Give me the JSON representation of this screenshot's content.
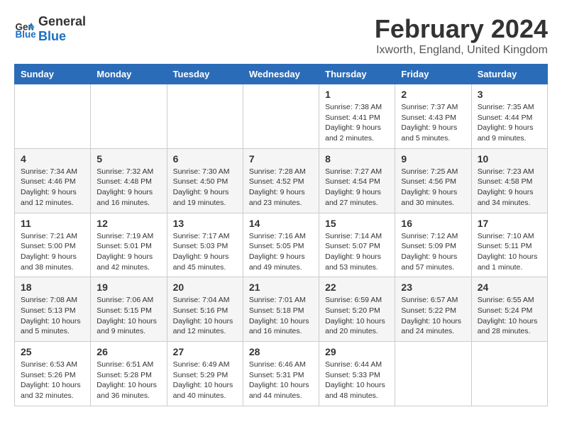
{
  "logo": {
    "line1": "General",
    "line2": "Blue"
  },
  "title": {
    "month_year": "February 2024",
    "location": "Ixworth, England, United Kingdom"
  },
  "days_of_week": [
    "Sunday",
    "Monday",
    "Tuesday",
    "Wednesday",
    "Thursday",
    "Friday",
    "Saturday"
  ],
  "weeks": [
    [
      {
        "day": "",
        "info": ""
      },
      {
        "day": "",
        "info": ""
      },
      {
        "day": "",
        "info": ""
      },
      {
        "day": "",
        "info": ""
      },
      {
        "day": "1",
        "info": "Sunrise: 7:38 AM\nSunset: 4:41 PM\nDaylight: 9 hours\nand 2 minutes."
      },
      {
        "day": "2",
        "info": "Sunrise: 7:37 AM\nSunset: 4:43 PM\nDaylight: 9 hours\nand 5 minutes."
      },
      {
        "day": "3",
        "info": "Sunrise: 7:35 AM\nSunset: 4:44 PM\nDaylight: 9 hours\nand 9 minutes."
      }
    ],
    [
      {
        "day": "4",
        "info": "Sunrise: 7:34 AM\nSunset: 4:46 PM\nDaylight: 9 hours\nand 12 minutes."
      },
      {
        "day": "5",
        "info": "Sunrise: 7:32 AM\nSunset: 4:48 PM\nDaylight: 9 hours\nand 16 minutes."
      },
      {
        "day": "6",
        "info": "Sunrise: 7:30 AM\nSunset: 4:50 PM\nDaylight: 9 hours\nand 19 minutes."
      },
      {
        "day": "7",
        "info": "Sunrise: 7:28 AM\nSunset: 4:52 PM\nDaylight: 9 hours\nand 23 minutes."
      },
      {
        "day": "8",
        "info": "Sunrise: 7:27 AM\nSunset: 4:54 PM\nDaylight: 9 hours\nand 27 minutes."
      },
      {
        "day": "9",
        "info": "Sunrise: 7:25 AM\nSunset: 4:56 PM\nDaylight: 9 hours\nand 30 minutes."
      },
      {
        "day": "10",
        "info": "Sunrise: 7:23 AM\nSunset: 4:58 PM\nDaylight: 9 hours\nand 34 minutes."
      }
    ],
    [
      {
        "day": "11",
        "info": "Sunrise: 7:21 AM\nSunset: 5:00 PM\nDaylight: 9 hours\nand 38 minutes."
      },
      {
        "day": "12",
        "info": "Sunrise: 7:19 AM\nSunset: 5:01 PM\nDaylight: 9 hours\nand 42 minutes."
      },
      {
        "day": "13",
        "info": "Sunrise: 7:17 AM\nSunset: 5:03 PM\nDaylight: 9 hours\nand 45 minutes."
      },
      {
        "day": "14",
        "info": "Sunrise: 7:16 AM\nSunset: 5:05 PM\nDaylight: 9 hours\nand 49 minutes."
      },
      {
        "day": "15",
        "info": "Sunrise: 7:14 AM\nSunset: 5:07 PM\nDaylight: 9 hours\nand 53 minutes."
      },
      {
        "day": "16",
        "info": "Sunrise: 7:12 AM\nSunset: 5:09 PM\nDaylight: 9 hours\nand 57 minutes."
      },
      {
        "day": "17",
        "info": "Sunrise: 7:10 AM\nSunset: 5:11 PM\nDaylight: 10 hours\nand 1 minute."
      }
    ],
    [
      {
        "day": "18",
        "info": "Sunrise: 7:08 AM\nSunset: 5:13 PM\nDaylight: 10 hours\nand 5 minutes."
      },
      {
        "day": "19",
        "info": "Sunrise: 7:06 AM\nSunset: 5:15 PM\nDaylight: 10 hours\nand 9 minutes."
      },
      {
        "day": "20",
        "info": "Sunrise: 7:04 AM\nSunset: 5:16 PM\nDaylight: 10 hours\nand 12 minutes."
      },
      {
        "day": "21",
        "info": "Sunrise: 7:01 AM\nSunset: 5:18 PM\nDaylight: 10 hours\nand 16 minutes."
      },
      {
        "day": "22",
        "info": "Sunrise: 6:59 AM\nSunset: 5:20 PM\nDaylight: 10 hours\nand 20 minutes."
      },
      {
        "day": "23",
        "info": "Sunrise: 6:57 AM\nSunset: 5:22 PM\nDaylight: 10 hours\nand 24 minutes."
      },
      {
        "day": "24",
        "info": "Sunrise: 6:55 AM\nSunset: 5:24 PM\nDaylight: 10 hours\nand 28 minutes."
      }
    ],
    [
      {
        "day": "25",
        "info": "Sunrise: 6:53 AM\nSunset: 5:26 PM\nDaylight: 10 hours\nand 32 minutes."
      },
      {
        "day": "26",
        "info": "Sunrise: 6:51 AM\nSunset: 5:28 PM\nDaylight: 10 hours\nand 36 minutes."
      },
      {
        "day": "27",
        "info": "Sunrise: 6:49 AM\nSunset: 5:29 PM\nDaylight: 10 hours\nand 40 minutes."
      },
      {
        "day": "28",
        "info": "Sunrise: 6:46 AM\nSunset: 5:31 PM\nDaylight: 10 hours\nand 44 minutes."
      },
      {
        "day": "29",
        "info": "Sunrise: 6:44 AM\nSunset: 5:33 PM\nDaylight: 10 hours\nand 48 minutes."
      },
      {
        "day": "",
        "info": ""
      },
      {
        "day": "",
        "info": ""
      }
    ]
  ]
}
